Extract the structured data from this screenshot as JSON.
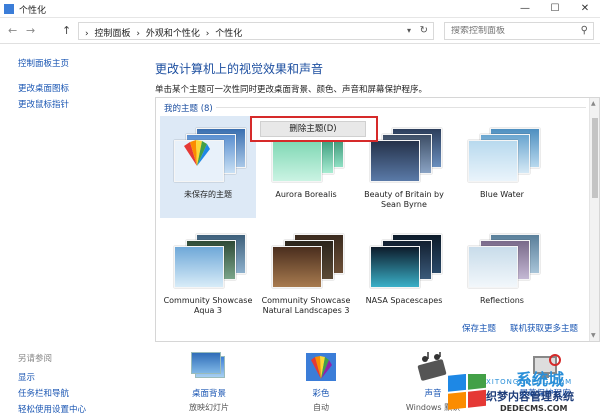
{
  "window": {
    "title": "个性化",
    "min": "—",
    "max": "☐",
    "close": "✕"
  },
  "nav": {
    "back": "←",
    "forward": "→",
    "up": "↑",
    "crumbs": [
      "控制面板",
      "外观和个性化",
      "个性化"
    ],
    "crumb_sep": "›",
    "search_placeholder": "搜索控制面板"
  },
  "sidebar": {
    "links": [
      "控制面板主页",
      "更改桌面图标",
      "更改鼠标指针"
    ],
    "see_also_title": "另请参阅",
    "see_also": [
      "显示",
      "任务栏和导航",
      "轻松使用设置中心"
    ]
  },
  "main": {
    "heading": "更改计算机上的视觉效果和声音",
    "description": "单击某个主题可一次性同时更改桌面背景、颜色、声音和屏幕保护程序。",
    "group_title": "我的主题 (8)",
    "themes": [
      {
        "label": "未保存的主题",
        "selected": true,
        "colors": [
          "#3a6fb0",
          "#a9c8e8"
        ]
      },
      {
        "label": "Aurora Borealis",
        "selected": false,
        "colors": [
          "#1f7a5a",
          "#8fe0c4"
        ]
      },
      {
        "label": "Beauty of Britain by Sean Byrne",
        "selected": false,
        "colors": [
          "#2c3e5c",
          "#6a8fbf"
        ]
      },
      {
        "label": "Blue Water",
        "selected": false,
        "colors": [
          "#b8d9ee",
          "#eaf4fb"
        ]
      },
      {
        "label": "Community Showcase Aqua 3",
        "selected": false,
        "colors": [
          "#6fa8d8",
          "#d8ecf8"
        ]
      },
      {
        "label": "Community Showcase Natural Landscapes 3",
        "selected": false,
        "colors": [
          "#4a2e1e",
          "#a87b4f"
        ]
      },
      {
        "label": "NASA Spacescapes",
        "selected": false,
        "colors": [
          "#0d1b2a",
          "#3ab0c8"
        ]
      },
      {
        "label": "Reflections",
        "selected": false,
        "colors": [
          "#c8dcea",
          "#f2f7fb"
        ]
      }
    ],
    "save_theme": "保存主题",
    "get_more": "联机获取更多主题",
    "windows_default_peek": "Windows 默认主题"
  },
  "context_menu": {
    "delete_theme": "删除主题(D)"
  },
  "bottom": {
    "items": [
      {
        "title": "桌面背景",
        "subtitle": "放映幻灯片"
      },
      {
        "title": "彩色",
        "subtitle": "自动"
      },
      {
        "title": "声音",
        "subtitle": "Windows 默认"
      },
      {
        "title": "屏幕保护程序",
        "subtitle": ""
      }
    ]
  },
  "watermark": {
    "big": "系统城",
    "sub": "XITONGCHENG.COM",
    "text": "织梦内容管理系统",
    "url": "DEDECMS.COM"
  },
  "colors": {
    "link": "#1a56b3",
    "heading": "#1d4fa0",
    "selected_bg": "#dde9f6",
    "highlight": "#d62a2a"
  }
}
